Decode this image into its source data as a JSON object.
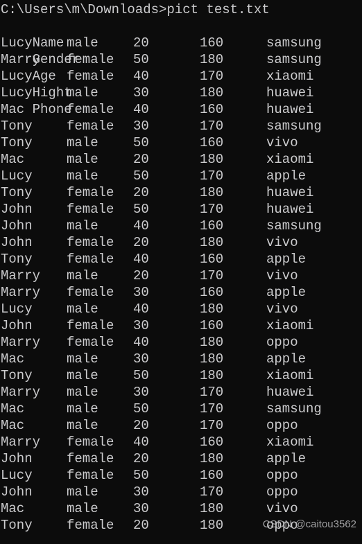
{
  "terminal": {
    "background_color": "#0c0c0c",
    "text_color": "#ccccce",
    "prompt_line": "C:\\Users\\m\\Downloads>pict test.txt"
  },
  "table": {
    "columns": [
      "Name",
      "Gender",
      "Age",
      "Hight",
      "Phone"
    ],
    "rows": [
      [
        "Lucy",
        "male",
        "20",
        "160",
        "samsung"
      ],
      [
        "Marry",
        "female",
        "50",
        "180",
        "samsung"
      ],
      [
        "Lucy",
        "female",
        "40",
        "170",
        "xiaomi"
      ],
      [
        "Lucy",
        "male",
        "30",
        "180",
        "huawei"
      ],
      [
        "Mac",
        "female",
        "40",
        "160",
        "huawei"
      ],
      [
        "Tony",
        "female",
        "30",
        "170",
        "samsung"
      ],
      [
        "Tony",
        "male",
        "50",
        "160",
        "vivo"
      ],
      [
        "Mac",
        "male",
        "20",
        "180",
        "xiaomi"
      ],
      [
        "Lucy",
        "male",
        "50",
        "170",
        "apple"
      ],
      [
        "Tony",
        "female",
        "20",
        "180",
        "huawei"
      ],
      [
        "John",
        "female",
        "50",
        "170",
        "huawei"
      ],
      [
        "John",
        "male",
        "40",
        "160",
        "samsung"
      ],
      [
        "John",
        "female",
        "20",
        "180",
        "vivo"
      ],
      [
        "Tony",
        "female",
        "40",
        "160",
        "apple"
      ],
      [
        "Marry",
        "male",
        "20",
        "170",
        "vivo"
      ],
      [
        "Marry",
        "female",
        "30",
        "160",
        "apple"
      ],
      [
        "Lucy",
        "male",
        "40",
        "180",
        "vivo"
      ],
      [
        "John",
        "female",
        "30",
        "160",
        "xiaomi"
      ],
      [
        "Marry",
        "female",
        "40",
        "180",
        "oppo"
      ],
      [
        "Mac",
        "male",
        "30",
        "180",
        "apple"
      ],
      [
        "Tony",
        "male",
        "50",
        "180",
        "xiaomi"
      ],
      [
        "Marry",
        "male",
        "30",
        "170",
        "huawei"
      ],
      [
        "Mac",
        "male",
        "50",
        "170",
        "samsung"
      ],
      [
        "Mac",
        "male",
        "20",
        "170",
        "oppo"
      ],
      [
        "Marry",
        "female",
        "40",
        "160",
        "xiaomi"
      ],
      [
        "John",
        "female",
        "20",
        "180",
        "apple"
      ],
      [
        "Lucy",
        "female",
        "50",
        "160",
        "oppo"
      ],
      [
        "John",
        "male",
        "30",
        "170",
        "oppo"
      ],
      [
        "Mac",
        "male",
        "30",
        "180",
        "vivo"
      ],
      [
        "Tony",
        "female",
        "20",
        "180",
        "oppo"
      ]
    ]
  },
  "watermark": {
    "text": "CSDN @caitou3562"
  }
}
